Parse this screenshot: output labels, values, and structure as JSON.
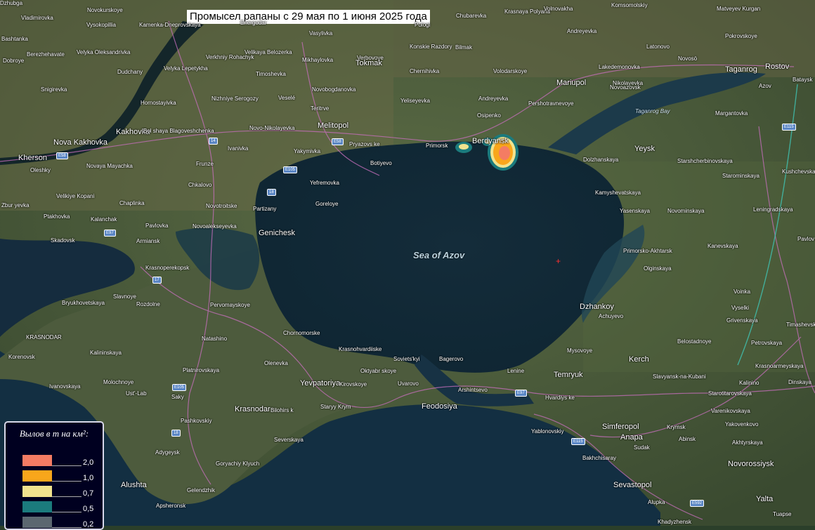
{
  "title": "Промысел рапаны с 29 мая по 1 июня 2025 года",
  "legend": {
    "title": "Вылов в т на км²:",
    "entries": [
      {
        "label": "2,0",
        "color": "#f47c63"
      },
      {
        "label": "1,0",
        "color": "#f8a61b"
      },
      {
        "label": "0,7",
        "color": "#f1e38e"
      },
      {
        "label": "0,5",
        "color": "#1b7b7d"
      },
      {
        "label": "0,2",
        "color": "#5b6770"
      }
    ]
  },
  "water_labels": {
    "sea": "Sea of Azov",
    "bay": "Taganrog Bay"
  },
  "places": [
    "Novokurskoye",
    "Vladimirovka",
    "Vysokopillia",
    "Kamenka-Dneprovskaya",
    "Energodar",
    "Vasylivka",
    "Pologi",
    "Chubarevka",
    "Krasnaya Polyana",
    "Volnovakha",
    "Komsomolskiy",
    "Matveyev Kurgan",
    "Bashtanka",
    "Velyka Oleksandrivka",
    "Verkhniy Rohachyk",
    "Velikaya Belozerka",
    "Mikhaylovka",
    "Verbovoye",
    "Konskie Razdory",
    "Andreyevka",
    "Latonovo",
    "Pokrovskoye",
    "Dobroye",
    "Berezhehavate",
    "Velyka Lepetykha",
    "Tokmak",
    "Bilmak",
    "Novosö",
    "Taganrog",
    "Rostov",
    "Snigirevka",
    "Dudchany",
    "Timoshevka",
    "Chernihivka",
    "Volodarskoye",
    "Mariupol",
    "Lakedemonovka",
    "Nikolayevka",
    "Hornostayivka",
    "Novobogdanovka",
    "Novoazovsk",
    "Azov",
    "Bataysk",
    "Nizhniye Serogozy",
    "Veselé",
    "Teritrve",
    "Yeliseyevka",
    "Andreyevka",
    "Pershotravnevoye",
    "Margantovka",
    "Kakhovka",
    "Bol shaya Blagoveshchenka",
    "Novo-Nikolayevka",
    "Melitopol",
    "Osipenko",
    "Nova Kakhovka",
    "Kherson",
    "Ivanivka",
    "Yakymivka",
    "Pryazovs ke",
    "Primorsk",
    "Berdyansk",
    "Yeysk",
    "Starshcherbinovskaya",
    "Oleshky",
    "Novaya Mayachka",
    "Frunze",
    "Botiyevo",
    "Dolzhanskaya",
    "Kushchevskaya",
    "Starominskaya",
    "Chkalovo",
    "Yefremovka",
    "Kamyshevatskaya",
    "Leningradskaya",
    "Velikiye Kopani",
    "Novotroitske",
    "Goreloye",
    "Yasenskaya",
    "Novominskaya",
    "Zbur yevka",
    "Chaplinka",
    "Partizany",
    "Ptakhovka",
    "Kalanchak",
    "Pavlovka",
    "Novoalekseyevka",
    "Genichesk",
    "Pavlov",
    "Skadovsk",
    "Armiansk",
    "Primorsko-Akhtarsk",
    "Kanevskaya",
    "Krasnoperekopsk",
    "Olginskaya",
    "Voinka",
    "Bryukhovetskaya",
    "Slavnoye",
    "Rozdolne",
    "Pervomayskoye",
    "Dzhankoy",
    "Achuyevo",
    "Grivenskaya",
    "Timashevsk",
    "Vyselki",
    "KRASNODAR",
    "Chornomorske",
    "Belostadnoye",
    "Kalininskaya",
    "Natashino",
    "Krasnohvardiiske",
    "Mysovoye",
    "Petrovskaya",
    "Korenovsk",
    "Olenevka",
    "Soviets'kyi",
    "Bagerovo",
    "Kerch",
    "Krasnoarmeyskaya",
    "Platnirovskaya",
    "Oktyabr skoye",
    "Lenine",
    "Temryuk",
    "Slavyansk-na-Kubani",
    "Ivanovskaya",
    "Molochnoye",
    "Yevpatoriya",
    "Kirovskoye",
    "Uvarovo",
    "Arshintsevo",
    "Starotitarovskaya",
    "Kalinino",
    "Dinskaya",
    "Ust'-Lab",
    "Saky",
    "Hvardiys ke",
    "Varenikovskaya",
    "Krasnodar",
    "Bilohirs k",
    "Staryy Krym",
    "Feodosiya",
    "Yakovenkovo",
    "Pashkovskiy",
    "Simferopol",
    "Krymsk",
    "Yablonovskiy",
    "Anapa",
    "Abinsk",
    "Severskaya",
    "Sudak",
    "Akhtyrskaya",
    "Adygeysk",
    "Bakhchisaray",
    "Novorossiysk",
    "Goryachiy Klyuch",
    "Alushta",
    "Sevastopol",
    "Gelendzhik",
    "Yalta",
    "Apsheronsk",
    "Alupka",
    "Tuapse",
    "Khadyzhensk",
    "Dzhubga"
  ],
  "roads": [
    "E58",
    "14",
    "E105",
    "18",
    "E97",
    "17",
    "E105",
    "18",
    "E58",
    "E115",
    "E97",
    "E115",
    "E592"
  ]
}
